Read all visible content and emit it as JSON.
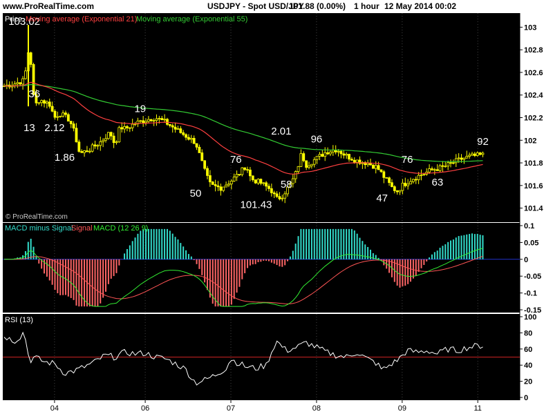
{
  "header": {
    "site": "www.ProRealTime.com",
    "instrument": "USDJPY - Spot USD/JPY",
    "price": "101.88 (0.00%)",
    "timeframe": "1 hour",
    "datetime": "12 May 2014 00:02"
  },
  "colors": {
    "panel_bg": "#000000",
    "candle": "#ffff00",
    "ema21": "#ff4040",
    "ema55": "#33cc33",
    "hist_pos": "#33ddcc",
    "hist_neg": "#ff6666",
    "signal": "#ff5555",
    "macd": "#33ee33",
    "rsi": "#ffffff",
    "rsi_level": "#cc2222",
    "labels": "#ffffff",
    "axis_text": "#000000"
  },
  "chart_data": [
    {
      "type": "candlestick",
      "panel": "price",
      "legend": {
        "price_label": "Price",
        "ema21_label": "Moving average (Exponential 21)",
        "ema55_label": "Moving average (Exponential 55)"
      },
      "watermark": "© ProRealTime.com",
      "ylim": [
        101.3,
        103.1
      ],
      "y_ticks": [
        101.4,
        101.6,
        101.8,
        102,
        102.2,
        102.4,
        102.6,
        102.8,
        103
      ],
      "y_tick_labels": [
        "101.4",
        "101.6",
        "101.8",
        "102",
        "102.2",
        "102.4",
        "102.6",
        "102.8",
        "103"
      ],
      "close_path": [
        [
          0,
          102.48
        ],
        [
          2,
          102.5
        ],
        [
          4,
          102.53
        ],
        [
          5,
          102.85
        ],
        [
          6,
          102.3
        ],
        [
          7,
          102.36
        ],
        [
          9,
          102.32
        ],
        [
          10,
          102.2
        ],
        [
          11,
          102.24
        ],
        [
          13,
          102.18
        ],
        [
          14,
          102.06
        ],
        [
          15,
          101.88
        ],
        [
          17,
          101.92
        ],
        [
          19,
          101.98
        ],
        [
          21,
          102.07
        ],
        [
          22,
          101.96
        ],
        [
          23,
          102.12
        ],
        [
          24,
          102.1
        ],
        [
          26,
          102.15
        ],
        [
          28,
          102.18
        ],
        [
          30,
          102.2
        ],
        [
          32,
          102.16
        ],
        [
          34,
          102.1
        ],
        [
          36,
          102.04
        ],
        [
          38,
          101.98
        ],
        [
          39,
          101.84
        ],
        [
          40,
          101.7
        ],
        [
          41,
          101.6
        ],
        [
          43,
          101.58
        ],
        [
          45,
          101.64
        ],
        [
          47,
          101.72
        ],
        [
          48,
          101.78
        ],
        [
          49,
          101.66
        ],
        [
          51,
          101.62
        ],
        [
          53,
          101.56
        ],
        [
          54,
          101.48
        ],
        [
          55,
          101.5
        ],
        [
          57,
          101.62
        ],
        [
          58,
          101.72
        ],
        [
          59,
          101.88
        ],
        [
          60,
          101.78
        ],
        [
          62,
          101.84
        ],
        [
          64,
          101.9
        ],
        [
          66,
          101.92
        ],
        [
          68,
          101.86
        ],
        [
          70,
          101.82
        ],
        [
          72,
          101.8
        ],
        [
          74,
          101.76
        ],
        [
          75,
          101.7
        ],
        [
          77,
          101.58
        ],
        [
          78,
          101.55
        ],
        [
          79,
          101.6
        ],
        [
          81,
          101.66
        ],
        [
          83,
          101.7
        ],
        [
          85,
          101.74
        ],
        [
          87,
          101.76
        ],
        [
          89,
          101.8
        ],
        [
          91,
          101.84
        ],
        [
          93,
          101.86
        ],
        [
          95,
          101.87
        ]
      ],
      "x_ticks": [
        {
          "label": "04",
          "x": 10
        },
        {
          "label": "06",
          "x": 28
        },
        {
          "label": "07",
          "x": 45
        },
        {
          "label": "08",
          "x": 62
        },
        {
          "label": "09",
          "x": 79
        },
        {
          "label": "11",
          "x": 94
        }
      ],
      "x_range": [
        0,
        100
      ],
      "annotations": [
        {
          "text": "103.02",
          "x": 4,
          "y": 103.02
        },
        {
          "text": "36",
          "x": 6,
          "y": 102.38
        },
        {
          "text": "13",
          "x": 5,
          "y": 102.08
        },
        {
          "text": "2.12",
          "x": 10,
          "y": 102.08
        },
        {
          "text": "1.86",
          "x": 12,
          "y": 101.82
        },
        {
          "text": "19",
          "x": 27,
          "y": 102.25
        },
        {
          "text": "2.01",
          "x": 55,
          "y": 102.05
        },
        {
          "text": "96",
          "x": 62,
          "y": 101.98
        },
        {
          "text": "76",
          "x": 46,
          "y": 101.8
        },
        {
          "text": "50",
          "x": 38,
          "y": 101.5
        },
        {
          "text": "101.43",
          "x": 50,
          "y": 101.4
        },
        {
          "text": "58",
          "x": 56,
          "y": 101.58
        },
        {
          "text": "76",
          "x": 80,
          "y": 101.8
        },
        {
          "text": "47",
          "x": 75,
          "y": 101.46
        },
        {
          "text": "63",
          "x": 86,
          "y": 101.6
        },
        {
          "text": "92",
          "x": 95,
          "y": 101.96
        }
      ]
    },
    {
      "type": "macd",
      "panel": "macd",
      "legend": {
        "hist_label": "MACD minus Signal",
        "signal_label": "Signal",
        "macd_label": "MACD (12 26 9)"
      },
      "ylim": [
        -0.15,
        0.1
      ],
      "y_ticks": [
        0.1,
        0.05,
        0,
        -0.05,
        -0.1,
        -0.15
      ],
      "y_tick_labels": [
        "0.1",
        "0.05",
        "0",
        "-0.05",
        "-0.1",
        "-0.15"
      ]
    },
    {
      "type": "line",
      "panel": "rsi",
      "legend": {
        "rsi_label": "RSI (13)"
      },
      "ylim": [
        0,
        100
      ],
      "y_ticks": [
        100,
        80,
        60,
        40,
        20,
        0
      ],
      "y_tick_labels": [
        "100",
        "80",
        "60",
        "40",
        "20",
        "0"
      ],
      "level": 50,
      "rsi_path": [
        [
          0,
          76
        ],
        [
          2,
          70
        ],
        [
          3,
          74
        ],
        [
          4,
          82
        ],
        [
          5,
          45
        ],
        [
          6,
          50
        ],
        [
          8,
          44
        ],
        [
          10,
          42
        ],
        [
          12,
          30
        ],
        [
          14,
          33
        ],
        [
          16,
          38
        ],
        [
          18,
          44
        ],
        [
          20,
          52
        ],
        [
          22,
          50
        ],
        [
          24,
          56
        ],
        [
          26,
          54
        ],
        [
          28,
          55
        ],
        [
          30,
          50
        ],
        [
          32,
          48
        ],
        [
          34,
          42
        ],
        [
          36,
          35
        ],
        [
          37,
          26
        ],
        [
          38,
          18
        ],
        [
          40,
          22
        ],
        [
          42,
          28
        ],
        [
          44,
          36
        ],
        [
          45,
          48
        ],
        [
          46,
          44
        ],
        [
          48,
          38
        ],
        [
          50,
          36
        ],
        [
          52,
          40
        ],
        [
          53,
          55
        ],
        [
          54,
          70
        ],
        [
          56,
          58
        ],
        [
          58,
          62
        ],
        [
          60,
          68
        ],
        [
          62,
          62
        ],
        [
          64,
          56
        ],
        [
          66,
          52
        ],
        [
          68,
          50
        ],
        [
          70,
          56
        ],
        [
          72,
          48
        ],
        [
          74,
          42
        ],
        [
          75,
          34
        ],
        [
          76,
          38
        ],
        [
          78,
          46
        ],
        [
          80,
          58
        ],
        [
          82,
          56
        ],
        [
          84,
          58
        ],
        [
          86,
          54
        ],
        [
          88,
          60
        ],
        [
          90,
          58
        ],
        [
          92,
          62
        ],
        [
          94,
          64
        ],
        [
          95,
          64
        ]
      ]
    }
  ]
}
